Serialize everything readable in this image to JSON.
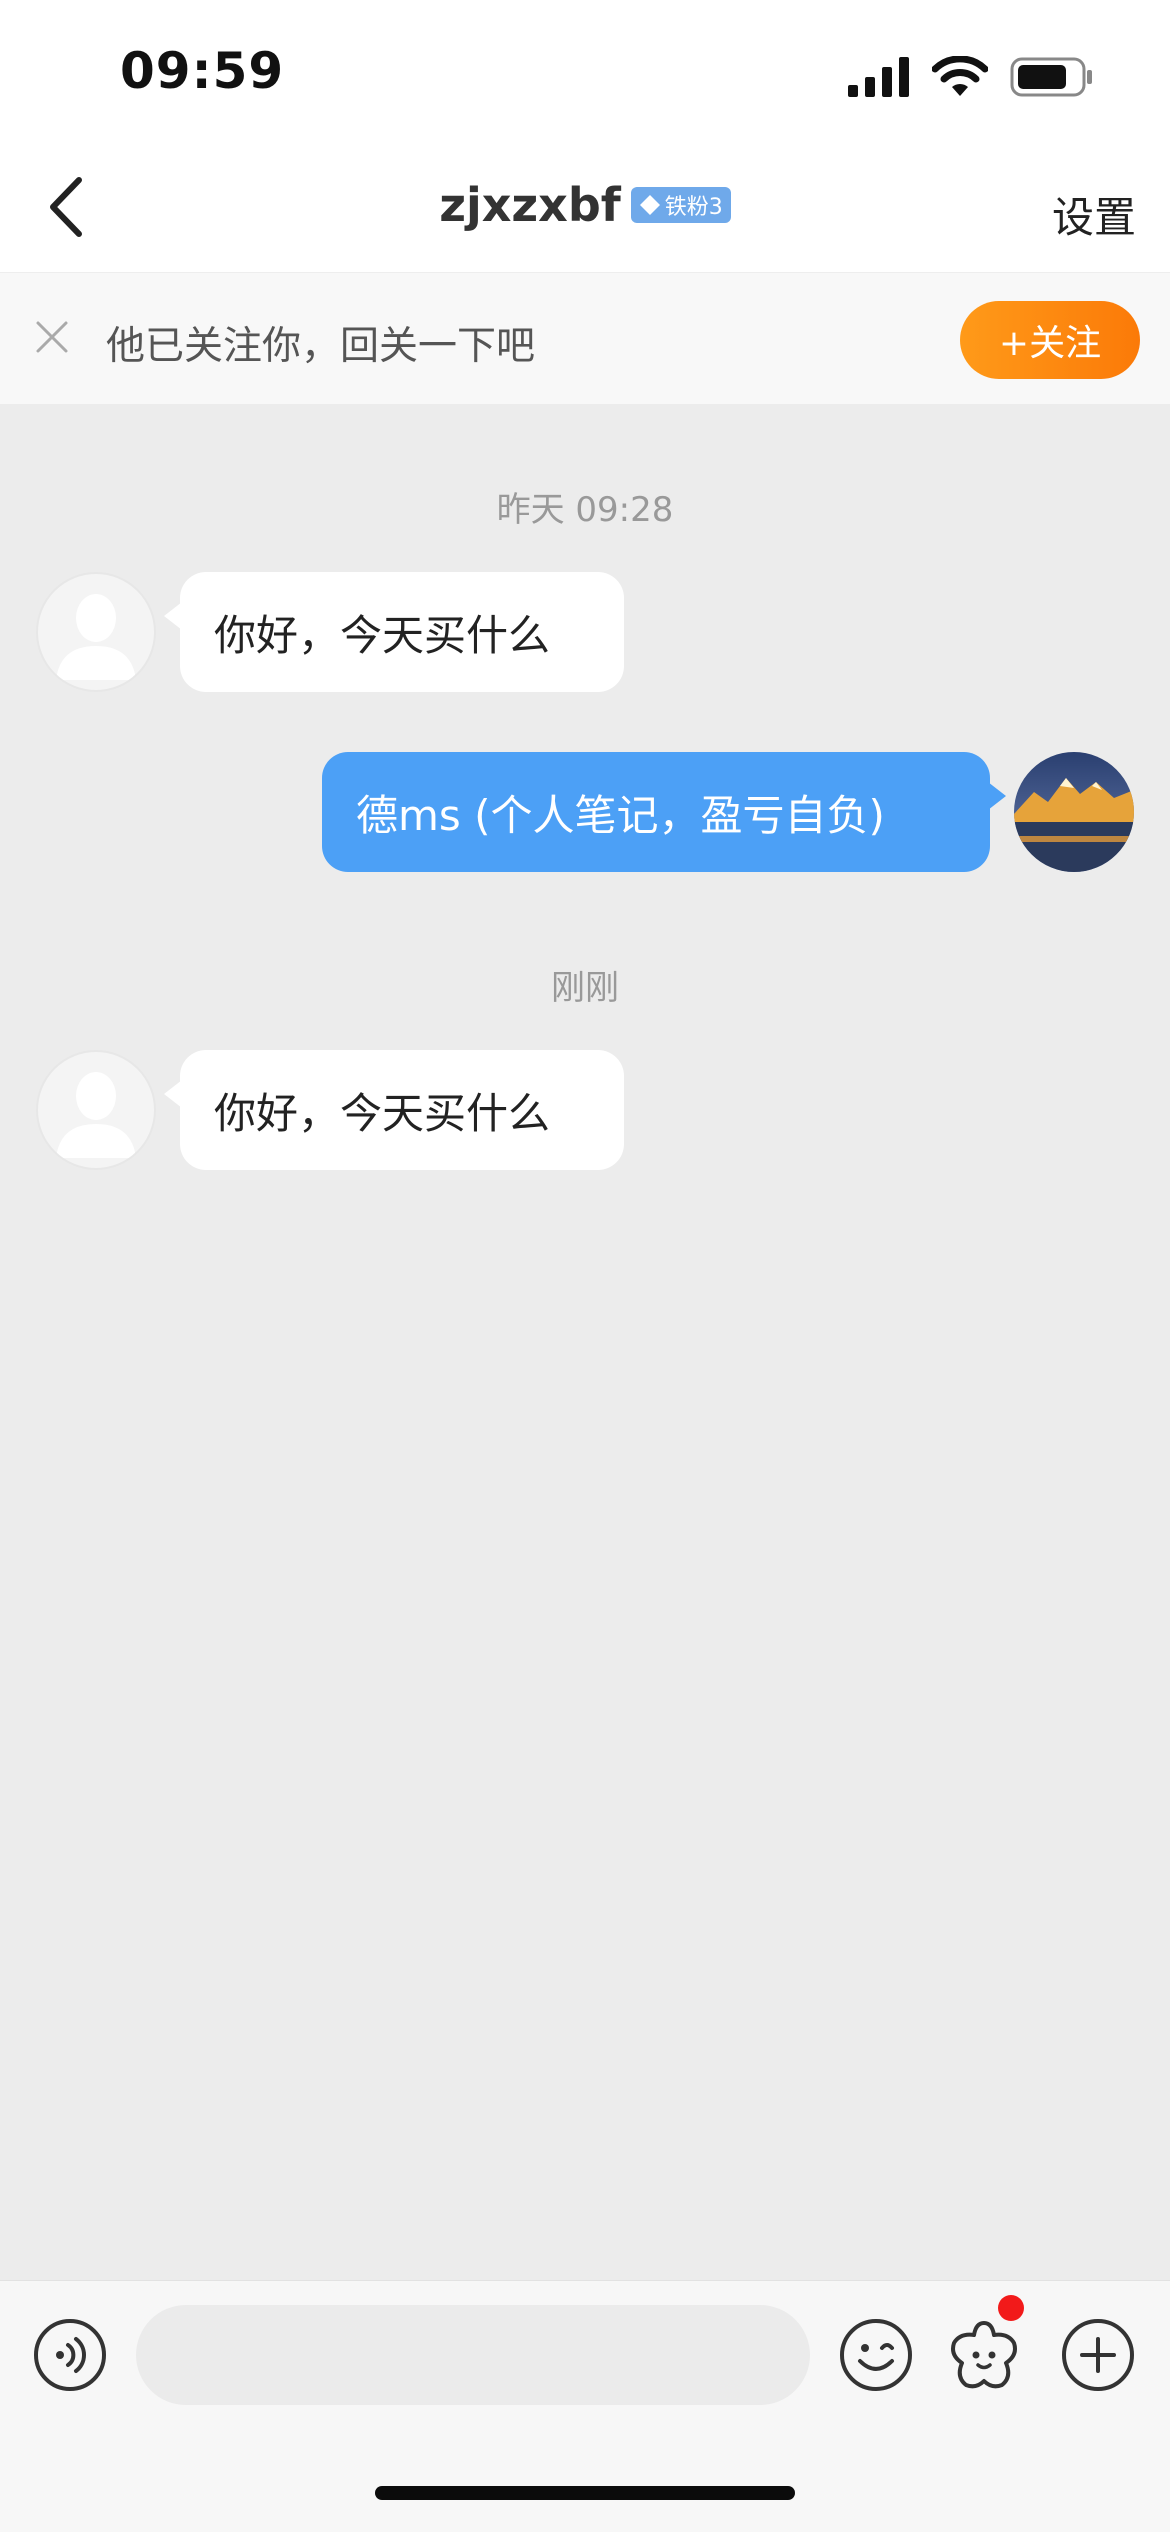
{
  "status_bar": {
    "time": "09:59"
  },
  "nav": {
    "title": "zjxzxbf",
    "badge_label": "铁粉3",
    "settings_label": "设置"
  },
  "follow_banner": {
    "text": "他已关注你，回关一下吧",
    "follow_button": "+关注"
  },
  "messages": [
    {
      "type": "timestamp",
      "text": "昨天 09:28"
    },
    {
      "type": "incoming",
      "text": "你好，今天买什么"
    },
    {
      "type": "outgoing",
      "text": "德ms (个人笔记，盈亏自负)"
    },
    {
      "type": "timestamp",
      "text": "刚刚"
    },
    {
      "type": "incoming",
      "text": "你好，今天买什么"
    }
  ],
  "input_bar": {
    "placeholder": "",
    "has_notification_dot": true
  },
  "colors": {
    "accent_orange": "#fb7a08",
    "outgoing_bubble": "#4ca0f6",
    "chat_background": "#ececec",
    "badge_blue": "#6fa9ea",
    "notification_red": "#f21a1a"
  }
}
